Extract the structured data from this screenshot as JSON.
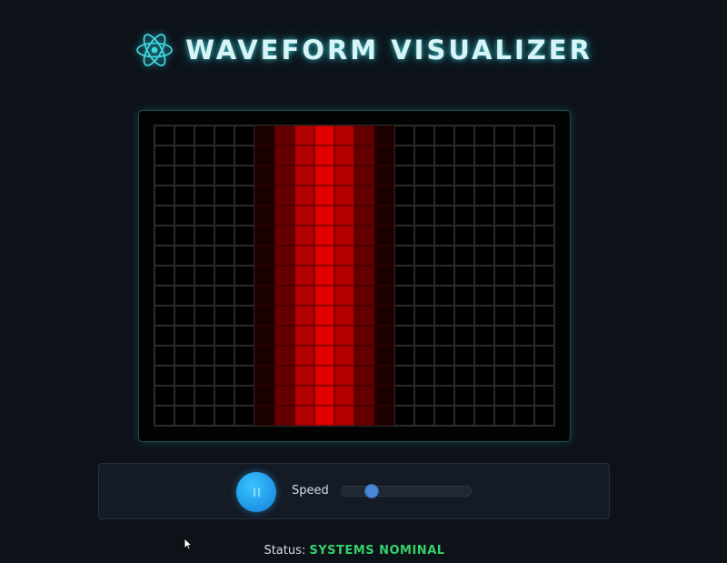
{
  "header": {
    "title": "WAVEFORM VISUALIZER",
    "logo_icon": "atom-icon",
    "accent_color": "#3fd6df"
  },
  "visualizer": {
    "columns": 20,
    "rows": 15,
    "column_intensity": [
      0,
      0,
      0,
      0,
      0,
      0.12,
      0.45,
      0.8,
      1.0,
      0.8,
      0.45,
      0.12,
      0,
      0,
      0,
      0,
      0,
      0,
      0,
      0
    ],
    "active_color": "#e00000"
  },
  "controls": {
    "play_pause_icon": "pause-icon",
    "speed_label": "Speed",
    "speed_level": 0.2
  },
  "status": {
    "label": "Status:",
    "value": "SYSTEMS NOMINAL",
    "value_color": "#35d06a"
  }
}
